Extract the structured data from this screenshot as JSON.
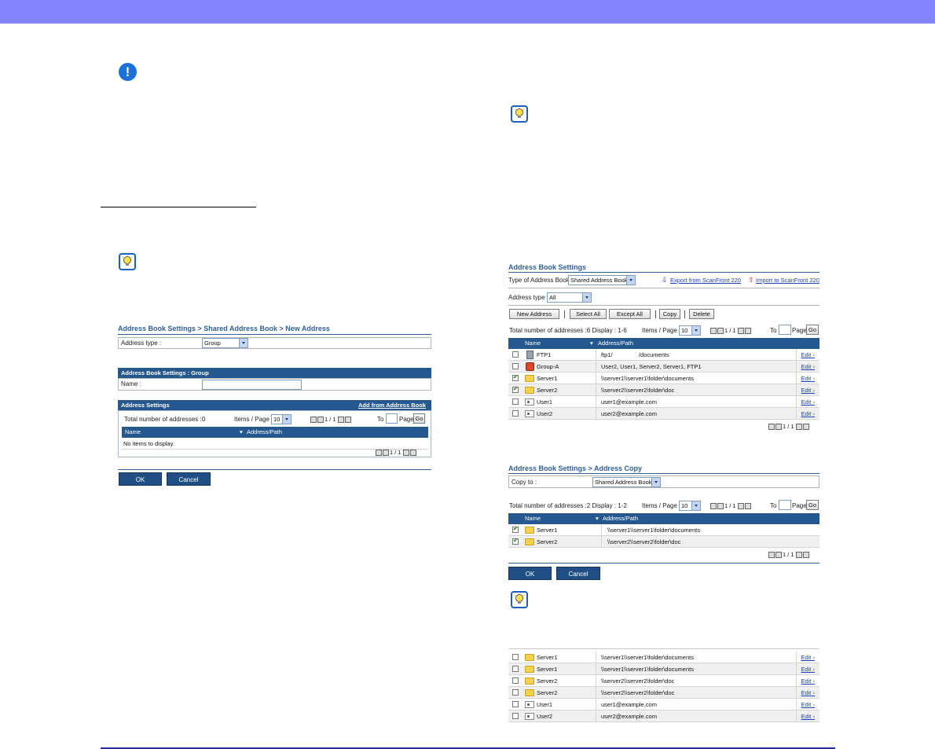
{
  "colors": {
    "header_bar": "#8484ff",
    "table_header": "#25588e",
    "crumb": "#2f5f99",
    "link": "#1a3fbf"
  },
  "icons": {
    "warning": "exclamation-circle-icon",
    "hint": "lightbulb-icon"
  },
  "left": {
    "crumb": "Address Book Settings > Shared Address Book > New Address",
    "address_type_label": "Address type :",
    "address_type_value": "Group",
    "group_header": "Address Book Settings : Group",
    "name_label": "Name :",
    "name_value": "",
    "settings_header": "Address Settings",
    "add_from_link": "Add from Address Book",
    "total": "Total number of addresses :0",
    "items_per_page_label": "Items / Page :",
    "items_per_page_value": "10",
    "page_display": "1 / 1",
    "to_label": "To",
    "page_label": "Page",
    "go": "Go",
    "col_name": "Name",
    "col_path": "Address/Path",
    "empty": "No items to display.",
    "ok": "OK",
    "cancel": "Cancel"
  },
  "book": {
    "title": "Address Book Settings",
    "type_label": "Type of Address Book :",
    "type_value": "Shared Address Book",
    "export_link": "Export from ScanFront 220",
    "import_link": "Import to ScanFront 220",
    "address_type_label": "Address type :",
    "address_type_value": "All",
    "buttons": {
      "new": "New Address",
      "select_all": "Select All",
      "except_all": "Except All",
      "copy": "Copy",
      "delete": "Delete"
    },
    "total": "Total number of addresses :6 Display : 1-6",
    "items_per_page_label": "Items / Page :",
    "items_per_page_value": "10",
    "page_display": "1 / 1",
    "to_label": "To",
    "page_label": "Page",
    "go": "Go",
    "col_name": "Name",
    "col_path": "Address/Path",
    "edit": "Edit",
    "rows": [
      {
        "name": "FTP1",
        "path": "ftp1/                /documents",
        "icon": "ftp-server-icon",
        "checked": false
      },
      {
        "name": "Group-A",
        "path": "User2, User1, Server2, Server1, FTP1",
        "icon": "group-icon",
        "checked": false
      },
      {
        "name": "Server1",
        "path": "\\\\server1\\\\server1\\folder\\documents",
        "icon": "folder-icon",
        "checked": true
      },
      {
        "name": "Server2",
        "path": "\\\\server2\\\\server2\\folder\\doc",
        "icon": "folder-icon",
        "checked": true
      },
      {
        "name": "User1",
        "path": "user1@example.com",
        "icon": "user-card-icon",
        "checked": false
      },
      {
        "name": "User2",
        "path": "user2@example.com",
        "icon": "user-card-icon",
        "checked": false
      }
    ]
  },
  "copy": {
    "crumb": "Address Book Settings > Address Copy",
    "copy_to_label": "Copy to :",
    "copy_to_value": "Shared Address Book",
    "total": "Total number of addresses :2 Display : 1-2",
    "items_per_page_label": "Items / Page :",
    "items_per_page_value": "10",
    "page_display": "1 / 1",
    "to_label": "To",
    "page_label": "Page",
    "go": "Go",
    "col_name": "Name",
    "col_path": "Address/Path",
    "rows": [
      {
        "name": "Server1",
        "path": "\\\\server1\\\\server1\\folder\\documents"
      },
      {
        "name": "Server2",
        "path": "\\\\server2\\\\server2\\folder\\doc"
      }
    ],
    "ok": "OK",
    "cancel": "Cancel"
  },
  "result": {
    "edit": "Edit",
    "rows": [
      {
        "name": "Server1",
        "path": "\\\\server1\\\\server1\\folder\\documents",
        "icon": "folder-icon"
      },
      {
        "name": "Server1",
        "path": "\\\\server1\\\\server1\\folder\\documents",
        "icon": "folder-icon"
      },
      {
        "name": "Server2",
        "path": "\\\\server2\\\\server2\\folder\\doc",
        "icon": "folder-icon"
      },
      {
        "name": "Server2",
        "path": "\\\\server2\\\\server2\\folder\\doc",
        "icon": "folder-icon"
      },
      {
        "name": "User1",
        "path": "user1@example.com",
        "icon": "user-card-icon"
      },
      {
        "name": "User2",
        "path": "user2@example.com",
        "icon": "user-card-icon"
      }
    ]
  }
}
